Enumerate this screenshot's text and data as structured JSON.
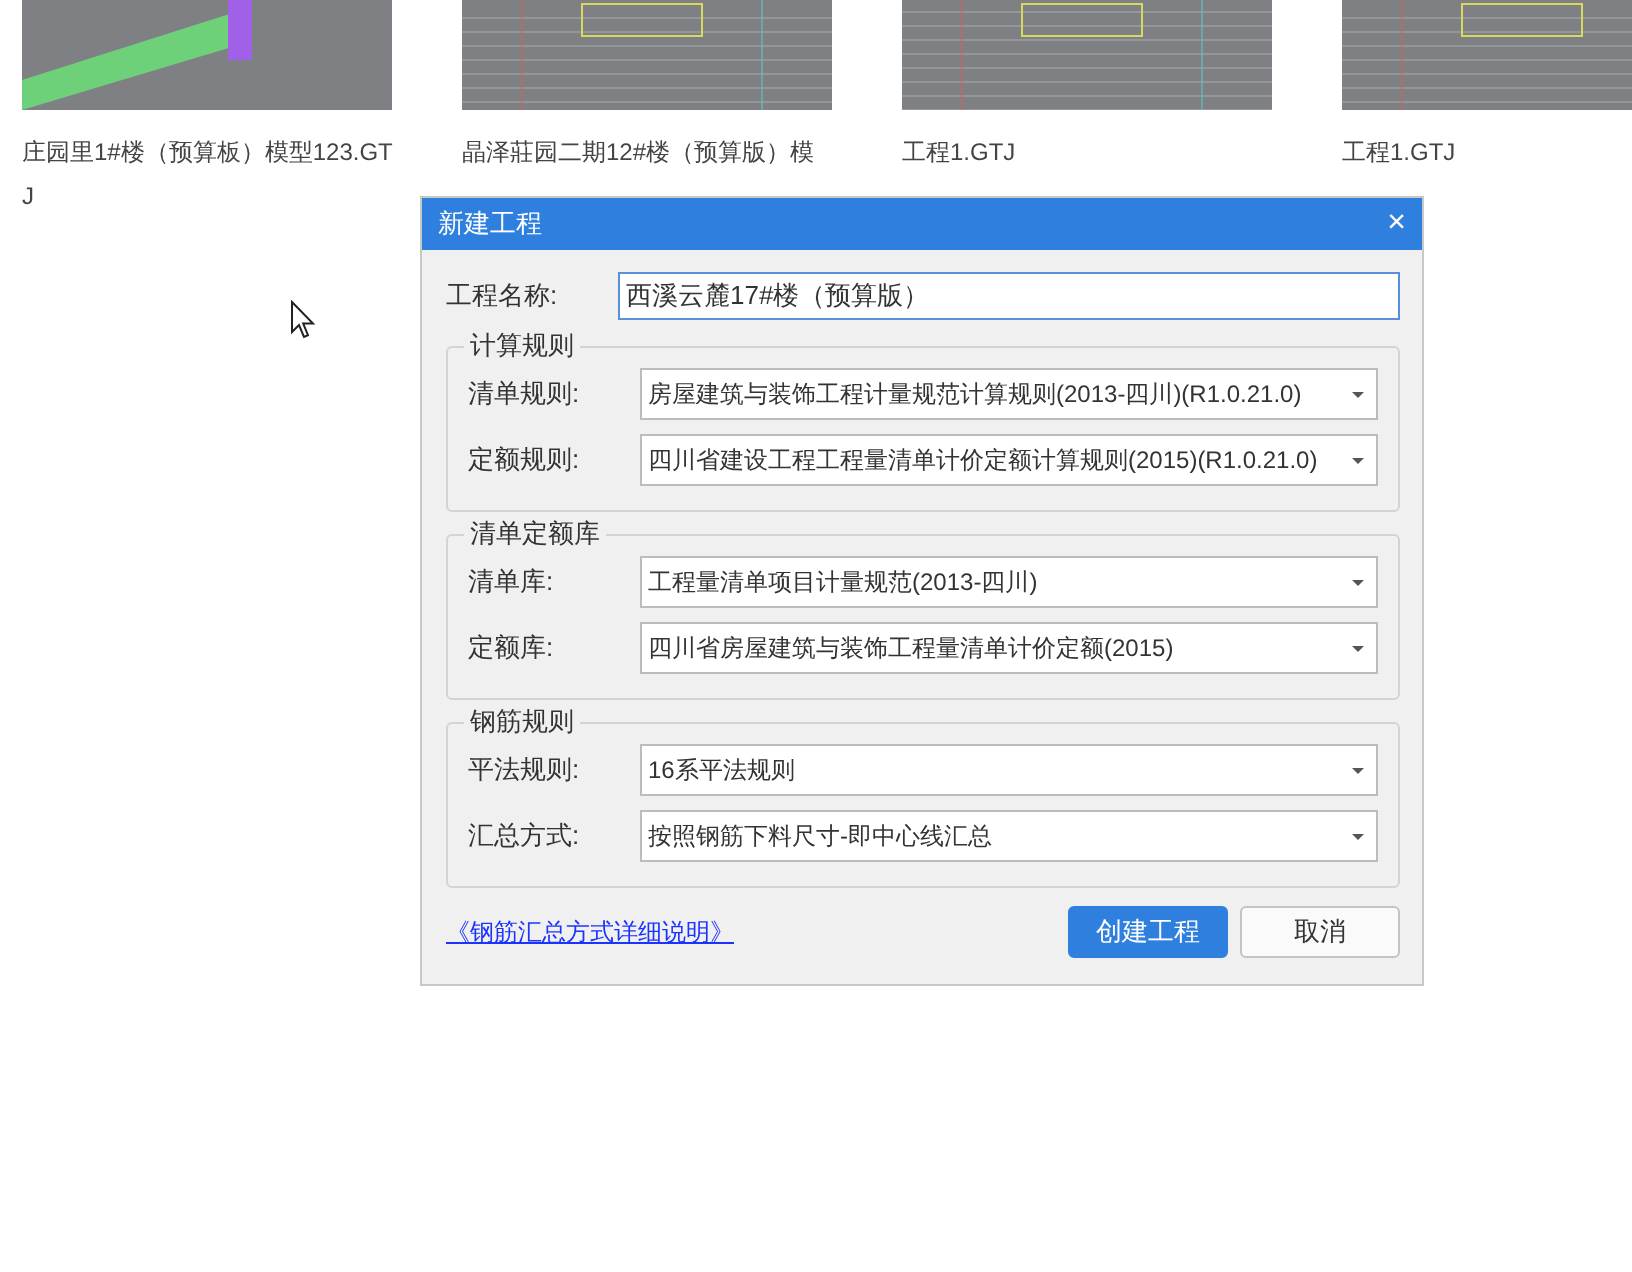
{
  "projects": [
    {
      "label": "庄园里1#楼（预算板）模型123.GTJ",
      "kind": "picture"
    },
    {
      "label": "晶泽莊园二期12#楼（预算版）模",
      "kind": "picture"
    },
    {
      "label": "工程1.GTJ",
      "kind": "picture"
    },
    {
      "label": "工程1.GTJ",
      "kind": "picture"
    }
  ],
  "dialog": {
    "title": "新建工程",
    "close": "×",
    "name_label": "工程名称:",
    "name_value": "西溪云麓17#楼（预算版）",
    "groups": [
      {
        "title": "计算规则",
        "rows": [
          {
            "label": "清单规则:",
            "value": "房屋建筑与装饰工程计量规范计算规则(2013-四川)(R1.0.21.0)"
          },
          {
            "label": "定额规则:",
            "value": "四川省建设工程工程量清单计价定额计算规则(2015)(R1.0.21.0)"
          }
        ]
      },
      {
        "title": "清单定额库",
        "rows": [
          {
            "label": "清单库:",
            "value": "工程量清单项目计量规范(2013-四川)"
          },
          {
            "label": "定额库:",
            "value": "四川省房屋建筑与装饰工程量清单计价定额(2015)"
          }
        ]
      },
      {
        "title": "钢筋规则",
        "rows": [
          {
            "label": "平法规则:",
            "value": "16系平法规则"
          },
          {
            "label": "汇总方式:",
            "value": "按照钢筋下料尺寸-即中心线汇总"
          }
        ]
      }
    ],
    "link": "《钢筋汇总方式详细说明》",
    "buttons": [
      {
        "label": "创建工程",
        "kind": "primary"
      },
      {
        "label": "取消",
        "kind": "secondary"
      }
    ]
  }
}
